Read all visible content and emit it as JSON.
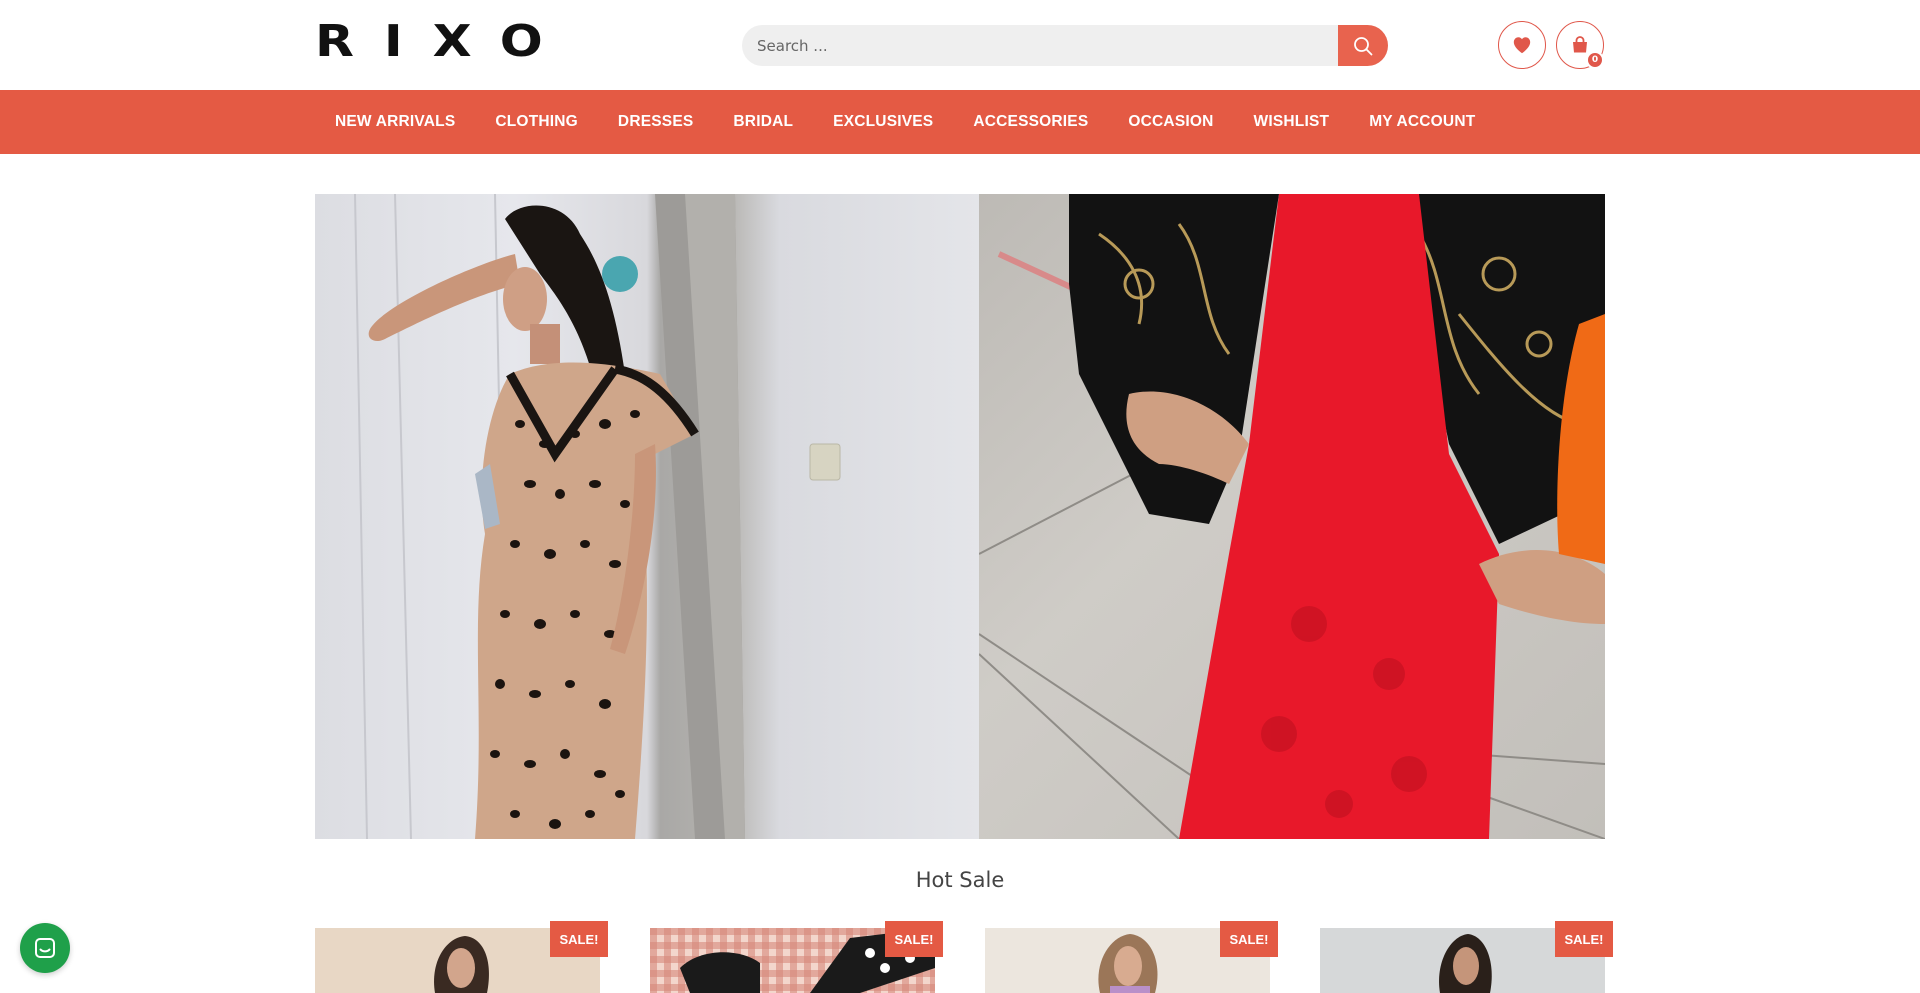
{
  "brand": {
    "logo_text": "RIXO"
  },
  "search": {
    "placeholder": "Search ..."
  },
  "header": {
    "cart_count": "0"
  },
  "nav": {
    "items": [
      "NEW ARRIVALS",
      "CLOTHING",
      "DRESSES",
      "BRIDAL",
      "EXCLUSIVES",
      "ACCESSORIES",
      "OCCASION",
      "WISHLIST",
      "MY ACCOUNT"
    ]
  },
  "hot_sale": {
    "title": "Hot Sale",
    "badge": "SALE!",
    "products": [
      {
        "badge": "SALE!"
      },
      {
        "badge": "SALE!"
      },
      {
        "badge": "SALE!"
      },
      {
        "badge": "SALE!"
      }
    ]
  },
  "colors": {
    "accent": "#e45a44",
    "chat": "#1fa04a"
  },
  "icons": {
    "search": "search-icon",
    "wishlist": "heart-icon",
    "cart": "shopping-bag-icon",
    "chat": "chat-icon"
  }
}
